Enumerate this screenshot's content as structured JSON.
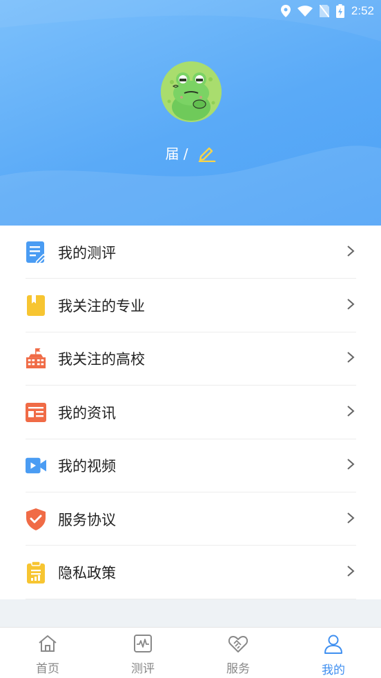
{
  "status_bar": {
    "time": "2:52"
  },
  "profile": {
    "text": "届 /"
  },
  "menu": {
    "items": [
      {
        "label": "我的测评",
        "icon": "assessment-icon",
        "color": "#4a9cf3"
      },
      {
        "label": "我关注的专业",
        "icon": "bookmark-icon",
        "color": "#f7c531"
      },
      {
        "label": "我关注的高校",
        "icon": "school-icon",
        "color": "#f06b46"
      },
      {
        "label": "我的资讯",
        "icon": "news-icon",
        "color": "#f06b46"
      },
      {
        "label": "我的视频",
        "icon": "video-icon",
        "color": "#4a9cf3"
      },
      {
        "label": "服务协议",
        "icon": "shield-icon",
        "color": "#f06b46"
      },
      {
        "label": "隐私政策",
        "icon": "policy-icon",
        "color": "#f7c531"
      }
    ]
  },
  "tabbar": {
    "tabs": [
      {
        "label": "首页",
        "icon": "home-icon"
      },
      {
        "label": "测评",
        "icon": "assessment-tab-icon"
      },
      {
        "label": "服务",
        "icon": "handshake-icon"
      },
      {
        "label": "我的",
        "icon": "user-icon",
        "active": true
      }
    ]
  },
  "colors": {
    "header_start": "#7cc0fb",
    "header_end": "#4ea2f6",
    "accent": "#3f8ff0"
  }
}
